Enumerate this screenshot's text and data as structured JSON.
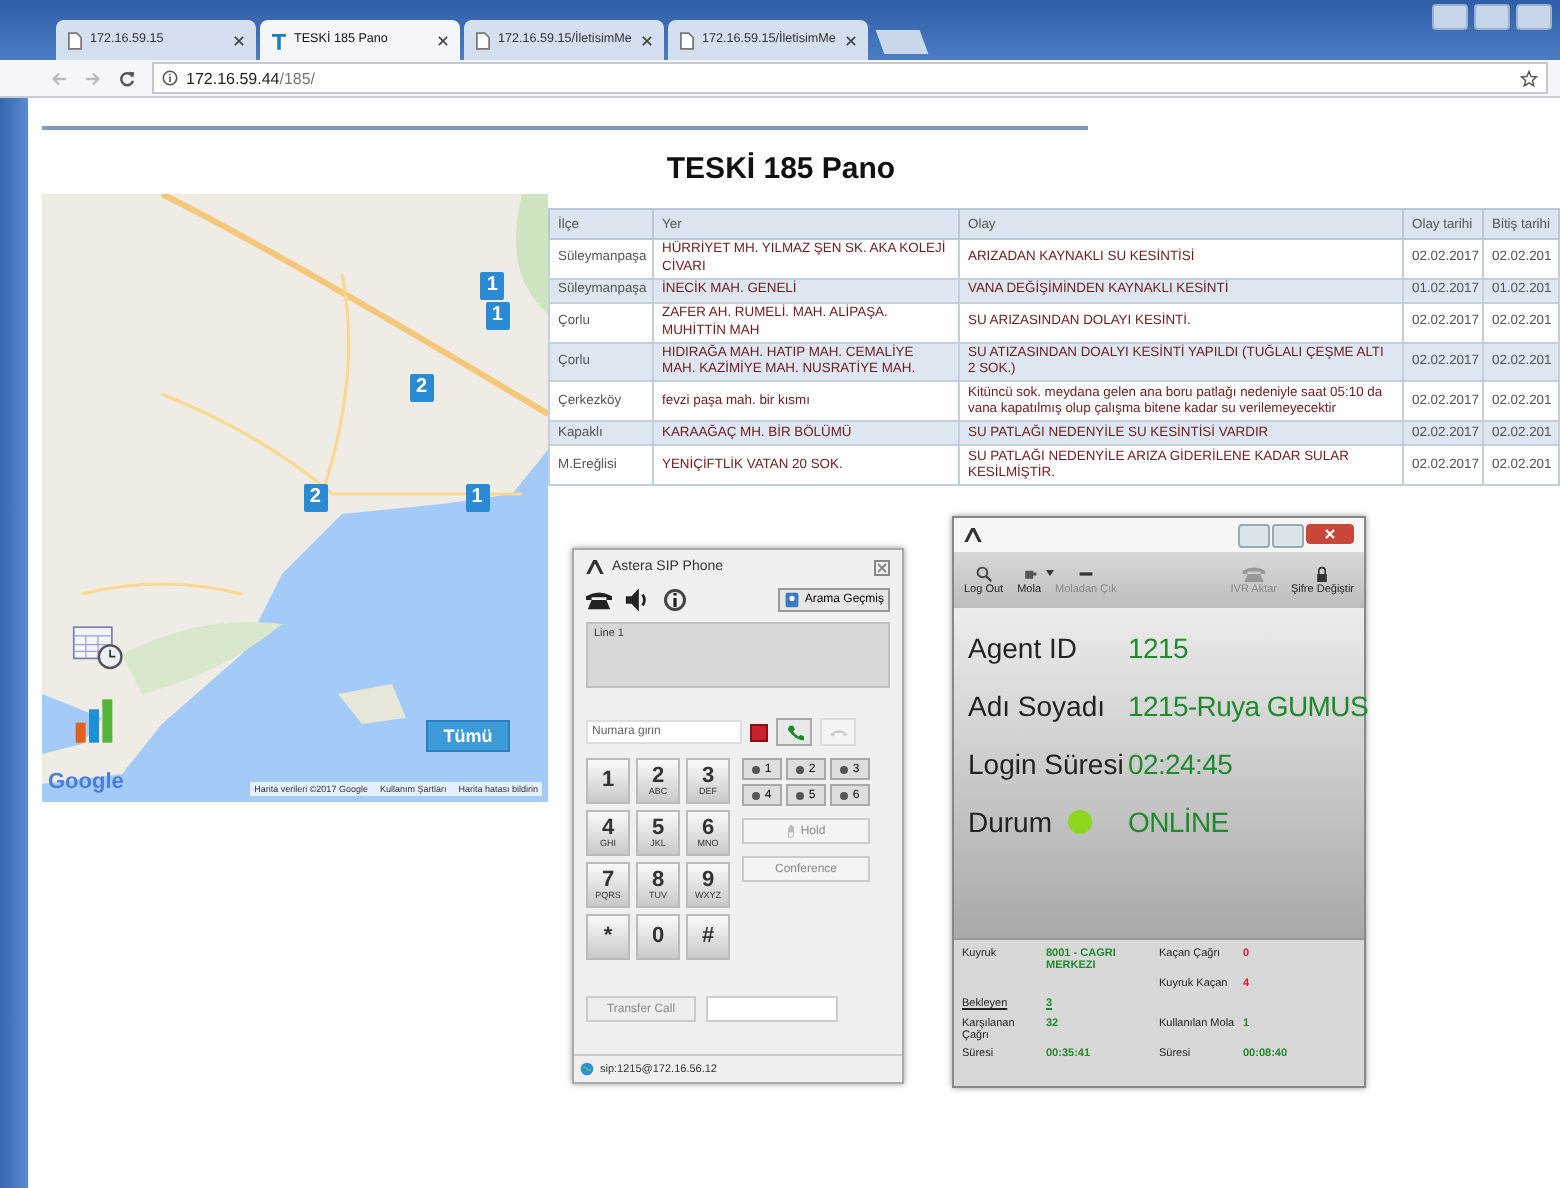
{
  "browser": {
    "tabs": [
      {
        "title": "172.16.59.15",
        "selected": false,
        "kind": "page"
      },
      {
        "title": "TESKİ 185 Pano",
        "selected": true,
        "kind": "site"
      },
      {
        "title": "172.16.59.15/İletisimMe",
        "selected": false,
        "kind": "page"
      },
      {
        "title": "172.16.59.15/İletisimMe",
        "selected": false,
        "kind": "page"
      }
    ],
    "address": {
      "host": "172.16.59.44",
      "path": "/185/"
    }
  },
  "page": {
    "title": "TESKİ 185 Pano"
  },
  "map": {
    "markers": [
      {
        "count": "1"
      },
      {
        "count": "1"
      },
      {
        "count": "2"
      },
      {
        "count": "2"
      },
      {
        "count": "1"
      }
    ],
    "all_button": "Tümü",
    "logo": "Google",
    "attribution": [
      "Harita verileri ©2017 Google",
      "Kullanım Şartları",
      "Harita hatası bildirin"
    ]
  },
  "table": {
    "columns": [
      "İlçe",
      "Yer",
      "Olay",
      "Olay tarihi",
      "Bitiş tarihi"
    ],
    "rows": [
      [
        "Süleymanpaşa",
        "HÜRRİYET MH. YILMAZ ŞEN SK. AKA KOLEJİ CİVARI",
        "ARIZADAN KAYNAKLI SU KESİNTİSİ",
        "02.02.2017",
        "02.02.201"
      ],
      [
        "Süleymanpaşa",
        "İNECİK MAH. GENELİ",
        "VANA DEĞİŞİMİNDEN KAYNAKLI KESİNTİ",
        "01.02.2017",
        "01.02.201"
      ],
      [
        "Çorlu",
        "ZAFER AH. RUMELİ. MAH. ALİPAŞA. MUHİTTİN MAH",
        "SU ARIZASINDAN DOLAYI KESİNTİ.",
        "02.02.2017",
        "02.02.201"
      ],
      [
        "Çorlu",
        "HIDIRAĞA MAH. HATIP MAH. CEMALİYE MAH.  KAZİMİYE MAH. NUSRATİYE MAH.",
        "SU ATIZASINDAN DOALYI KESİNTİ YAPILDI (TUĞLALI ÇEŞME ALTI 2 SOK.)",
        "02.02.2017",
        "02.02.201"
      ],
      [
        "Çerkezköy",
        "fevzi paşa mah. bir kısmı",
        "Kitüncü sok. meydana gelen ana boru patlağı nedeniyle saat 05:10 da vana kapatılmış olup çalışma bitene kadar su verilemeyecektir",
        "02.02.2017",
        "02.02.201"
      ],
      [
        "Kapaklı",
        "KARAAĞAÇ MH. BİR BÖLÜMÜ",
        "SU PATLAĞI NEDENYİLE SU KESİNTİSİ VARDIR",
        "02.02.2017",
        "02.02.201"
      ],
      [
        "M.Ereğlisi",
        "YENİÇİFTLİK VATAN 20 SOK.",
        "SU PATLAĞI NEDENYİLE ARIZA GİDERİLENE KADAR SULAR KESİLMİŞTİR.",
        "02.02.2017",
        "02.02.201"
      ]
    ]
  },
  "sip_phone": {
    "title": "Astera SIP Phone",
    "history_button": "Arama Geçmiş",
    "line_label": "Line 1",
    "number_field": {
      "placeholder": "Numara girin"
    },
    "keys": [
      {
        "digit": "1"
      },
      {
        "digit": "2",
        "letters": "ABC"
      },
      {
        "digit": "3",
        "letters": "DEF"
      },
      {
        "digit": "4",
        "letters": "GHI"
      },
      {
        "digit": "5",
        "letters": "JKL"
      },
      {
        "digit": "6",
        "letters": "MNO"
      },
      {
        "digit": "7",
        "letters": "PQRS"
      },
      {
        "digit": "8",
        "letters": "TUV"
      },
      {
        "digit": "9",
        "letters": "WXYZ"
      },
      {
        "digit": "*"
      },
      {
        "digit": "0"
      },
      {
        "digit": "#"
      }
    ],
    "line_buttons": [
      "1",
      "2",
      "3",
      "4",
      "5",
      "6"
    ],
    "hold": {
      "label": "Hold",
      "disabled": true
    },
    "conference": {
      "label": "Conference",
      "disabled": true
    },
    "transfer": {
      "label": "Transfer Call",
      "disabled": true
    },
    "status": "sip:1215@172.16.56.12"
  },
  "agent_panel": {
    "toolbar": [
      {
        "label": "Log Out",
        "kind": "magnifier",
        "disabled": false,
        "dropdown": false
      },
      {
        "label": "Mola",
        "kind": "break",
        "disabled": false,
        "dropdown": true
      },
      {
        "label": "Moladan Çık",
        "kind": "minus",
        "disabled": true,
        "dropdown": false
      },
      {
        "label": "IVR Aktar",
        "kind": "phone",
        "disabled": true,
        "dropdown": false
      },
      {
        "label": "Şifre Değiştir",
        "kind": "lock",
        "disabled": false,
        "dropdown": false
      }
    ],
    "fields": [
      {
        "label": "Agent ID",
        "value": "1215"
      },
      {
        "label": "Adı Soyadı",
        "value": "1215-Ruya GUMUS"
      },
      {
        "label": "Login Süresi",
        "value": "02:24:45"
      }
    ],
    "status": {
      "label": "Durum",
      "value": "ONLİNE"
    },
    "stats": [
      {
        "left": {
          "label": "Kuyruk",
          "value": "8001 - CAGRI MERKEZI",
          "kind": "normal"
        },
        "right": {
          "label": "Kaçan Çağrı",
          "value": "0",
          "kind": "alert"
        }
      },
      {
        "right": {
          "label": "Kuyruk Kaçan",
          "value": "4",
          "kind": "alert"
        }
      },
      {
        "left": {
          "label": "Bekleyen",
          "value": "3",
          "kind": "link"
        }
      },
      {
        "left": {
          "label": "Karşılanan Çağrı",
          "value": "32",
          "kind": "normal"
        },
        "right": {
          "label": "Kullanılan Mola",
          "value": "1",
          "kind": "normal"
        }
      },
      {
        "left": {
          "label": "Süresi",
          "value": "00:35:41",
          "kind": "normal"
        },
        "right": {
          "label": "Süresi",
          "value": "00:08:40",
          "kind": "normal"
        }
      }
    ]
  }
}
